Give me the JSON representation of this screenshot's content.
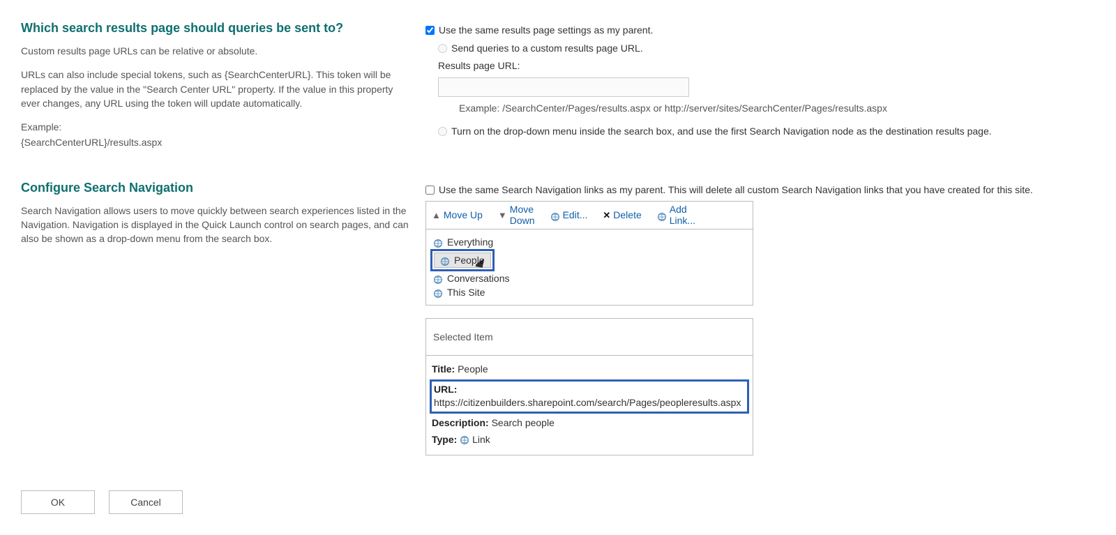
{
  "section1": {
    "title": "Which search results page should queries be sent to?",
    "desc1": "Custom results page URLs can be relative or absolute.",
    "desc2": "URLs can also include special tokens, such as {SearchCenterURL}. This token will be replaced by the value in the \"Search Center URL\" property. If the value in this property ever changes, any URL using the token will update automatically.",
    "exampleLabel": "Example:",
    "exampleValue": "{SearchCenterURL}/results.aspx",
    "chk_sameAsParent": "Use the same results page settings as my parent.",
    "radio_customPage": "Send queries to a custom results page URL.",
    "urlLabel": "Results page URL:",
    "urlExample": "Example: /SearchCenter/Pages/results.aspx or http://server/sites/SearchCenter/Pages/results.aspx",
    "radio_dropdown": "Turn on the drop-down menu inside the search box, and use the first Search Navigation node as the destination results page."
  },
  "section2": {
    "title": "Configure Search Navigation",
    "desc": "Search Navigation allows users to move quickly between search experiences listed in the Navigation. Navigation is displayed in the Quick Launch control on search pages, and can also be shown as a drop-down menu from the search box.",
    "chk_sameNav": "Use the same Search Navigation links as my parent. This will delete all custom Search Navigation links that you have created for this site.",
    "toolbar": {
      "moveUp": "Move Up",
      "moveDown": "Move Down",
      "edit": "Edit...",
      "delete": "Delete",
      "addLink": "Add Link..."
    },
    "navItems": [
      "Everything",
      "People",
      "Conversations",
      "This Site"
    ],
    "selectedPanel": {
      "header": "Selected Item",
      "titleLabel": "Title:",
      "titleValue": "People",
      "urlLabel": "URL:",
      "urlValue": "https://citizenbuilders.sharepoint.com/search/Pages/peopleresults.aspx",
      "descLabel": "Description:",
      "descValue": "Search people",
      "typeLabel": "Type:",
      "typeValue": "Link"
    }
  },
  "footer": {
    "ok": "OK",
    "cancel": "Cancel"
  }
}
